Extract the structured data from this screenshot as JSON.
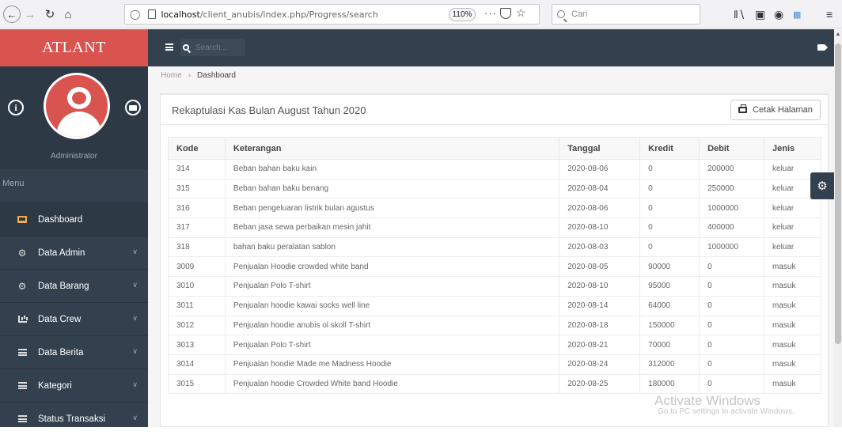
{
  "browser": {
    "url_host": "localhost",
    "url_path": "/client_anubis/index.php/Progress/search",
    "zoom": "110%",
    "search_placeholder": "Cari",
    "more_label": "···"
  },
  "sidebar": {
    "brand": "ATLANT",
    "profile_name": "Administrator",
    "menu_label": "Menu",
    "items": [
      {
        "label": "Dashboard",
        "icon": "monitor-icon"
      },
      {
        "label": "Data Admin",
        "icon": "cogs-icon"
      },
      {
        "label": "Data Barang",
        "icon": "cogs-icon"
      },
      {
        "label": "Data Crew",
        "icon": "bar-chart-icon"
      },
      {
        "label": "Data Berita",
        "icon": "list-icon"
      },
      {
        "label": "Kategori",
        "icon": "list-icon"
      },
      {
        "label": "Status Transaksi",
        "icon": "list-icon"
      }
    ],
    "accent_color": "#d9534f",
    "bg_color": "#33414e"
  },
  "topbar": {
    "search_placeholder": "Search..."
  },
  "breadcrumb": {
    "home": "Home",
    "current": "Dashboard"
  },
  "panel": {
    "title": "Rekaptulasi Kas Bulan August Tahun 2020",
    "print_label": "Cetak Halaman"
  },
  "table": {
    "headers": [
      "Kode",
      "Keterangan",
      "Tanggal",
      "Kredit",
      "Debit",
      "Jenis"
    ],
    "rows": [
      [
        "314",
        "Beban bahan baku kain",
        "2020-08-06",
        "0",
        "200000",
        "keluar"
      ],
      [
        "315",
        "Beban bahan baku benang",
        "2020-08-04",
        "0",
        "250000",
        "keluar"
      ],
      [
        "316",
        "Beban pengeluaran listrik bulan agustus",
        "2020-08-06",
        "0",
        "1000000",
        "keluar"
      ],
      [
        "317",
        "Beban jasa sewa perbaikan mesin jahit",
        "2020-08-10",
        "0",
        "400000",
        "keluar"
      ],
      [
        "318",
        "bahan baku peralatan sablon",
        "2020-08-03",
        "0",
        "1000000",
        "keluar"
      ],
      [
        "3009",
        "Penjualan Hoodie crowded white band",
        "2020-08-05",
        "90000",
        "0",
        "masuk"
      ],
      [
        "3010",
        "Penjualan Polo T-shirt",
        "2020-08-10",
        "95000",
        "0",
        "masuk"
      ],
      [
        "3011",
        "Penjualan hoodie kawai socks well line",
        "2020-08-14",
        "64000",
        "0",
        "masuk"
      ],
      [
        "3012",
        "Penjualan hoodie anubis ol skoll T-shirt",
        "2020-08-18",
        "150000",
        "0",
        "masuk"
      ],
      [
        "3013",
        "Penjualan Polo T-shirt",
        "2020-08-21",
        "70000",
        "0",
        "masuk"
      ],
      [
        "3014",
        "Penjualan hoodie Made me Madness Hoodie",
        "2020-08-24",
        "312000",
        "0",
        "masuk"
      ],
      [
        "3015",
        "Penjualan hoodie Crowded White band Hoodie",
        "2020-08-25",
        "180000",
        "0",
        "masuk"
      ]
    ]
  },
  "watermark": {
    "title": "Activate Windows",
    "subtitle": "Go to PC settings to activate Windows."
  }
}
